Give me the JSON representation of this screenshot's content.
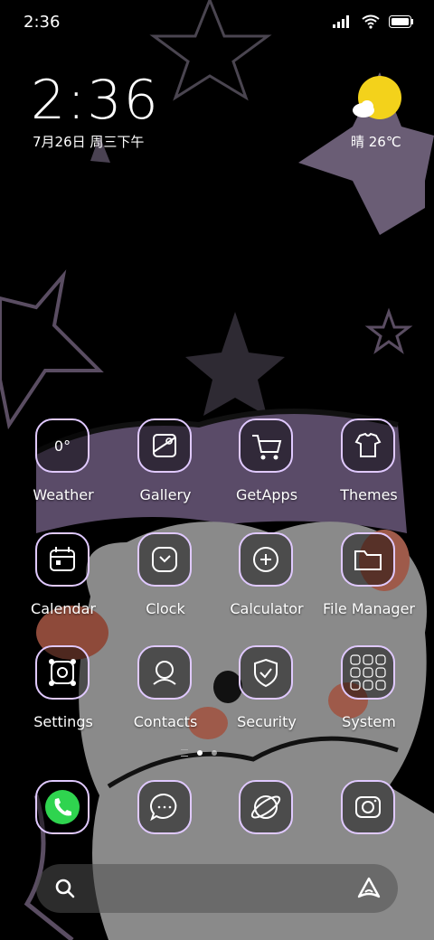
{
  "status_bar": {
    "time": "2:36"
  },
  "lockclock": {
    "time": "2:36",
    "date": "7月26日 周三下午"
  },
  "weather": {
    "text": "晴 26℃"
  },
  "apps": [
    {
      "label": "Weather",
      "icon": "weather-icon",
      "glyph": "0°"
    },
    {
      "label": "Gallery",
      "icon": "gallery-icon"
    },
    {
      "label": "GetApps",
      "icon": "cart-icon"
    },
    {
      "label": "Themes",
      "icon": "shirt-icon"
    },
    {
      "label": "Calendar",
      "icon": "calendar-icon"
    },
    {
      "label": "Clock",
      "icon": "clock-icon"
    },
    {
      "label": "Calculator",
      "icon": "calculator-icon"
    },
    {
      "label": "File Manager",
      "icon": "folder-icon"
    },
    {
      "label": "Settings",
      "icon": "gear-icon"
    },
    {
      "label": "Contacts",
      "icon": "contact-icon"
    },
    {
      "label": "Security",
      "icon": "shield-icon"
    },
    {
      "label": "System",
      "icon": "folder-grid-icon"
    }
  ],
  "dock": [
    {
      "icon": "phone-icon"
    },
    {
      "icon": "message-icon"
    },
    {
      "icon": "browser-planet-icon"
    },
    {
      "icon": "camera-icon"
    }
  ],
  "colors": {
    "accent": "#e0c9ff",
    "phone_green": "#2fd44f",
    "weather_sun": "#f3d21b",
    "star": "#5e5166"
  }
}
